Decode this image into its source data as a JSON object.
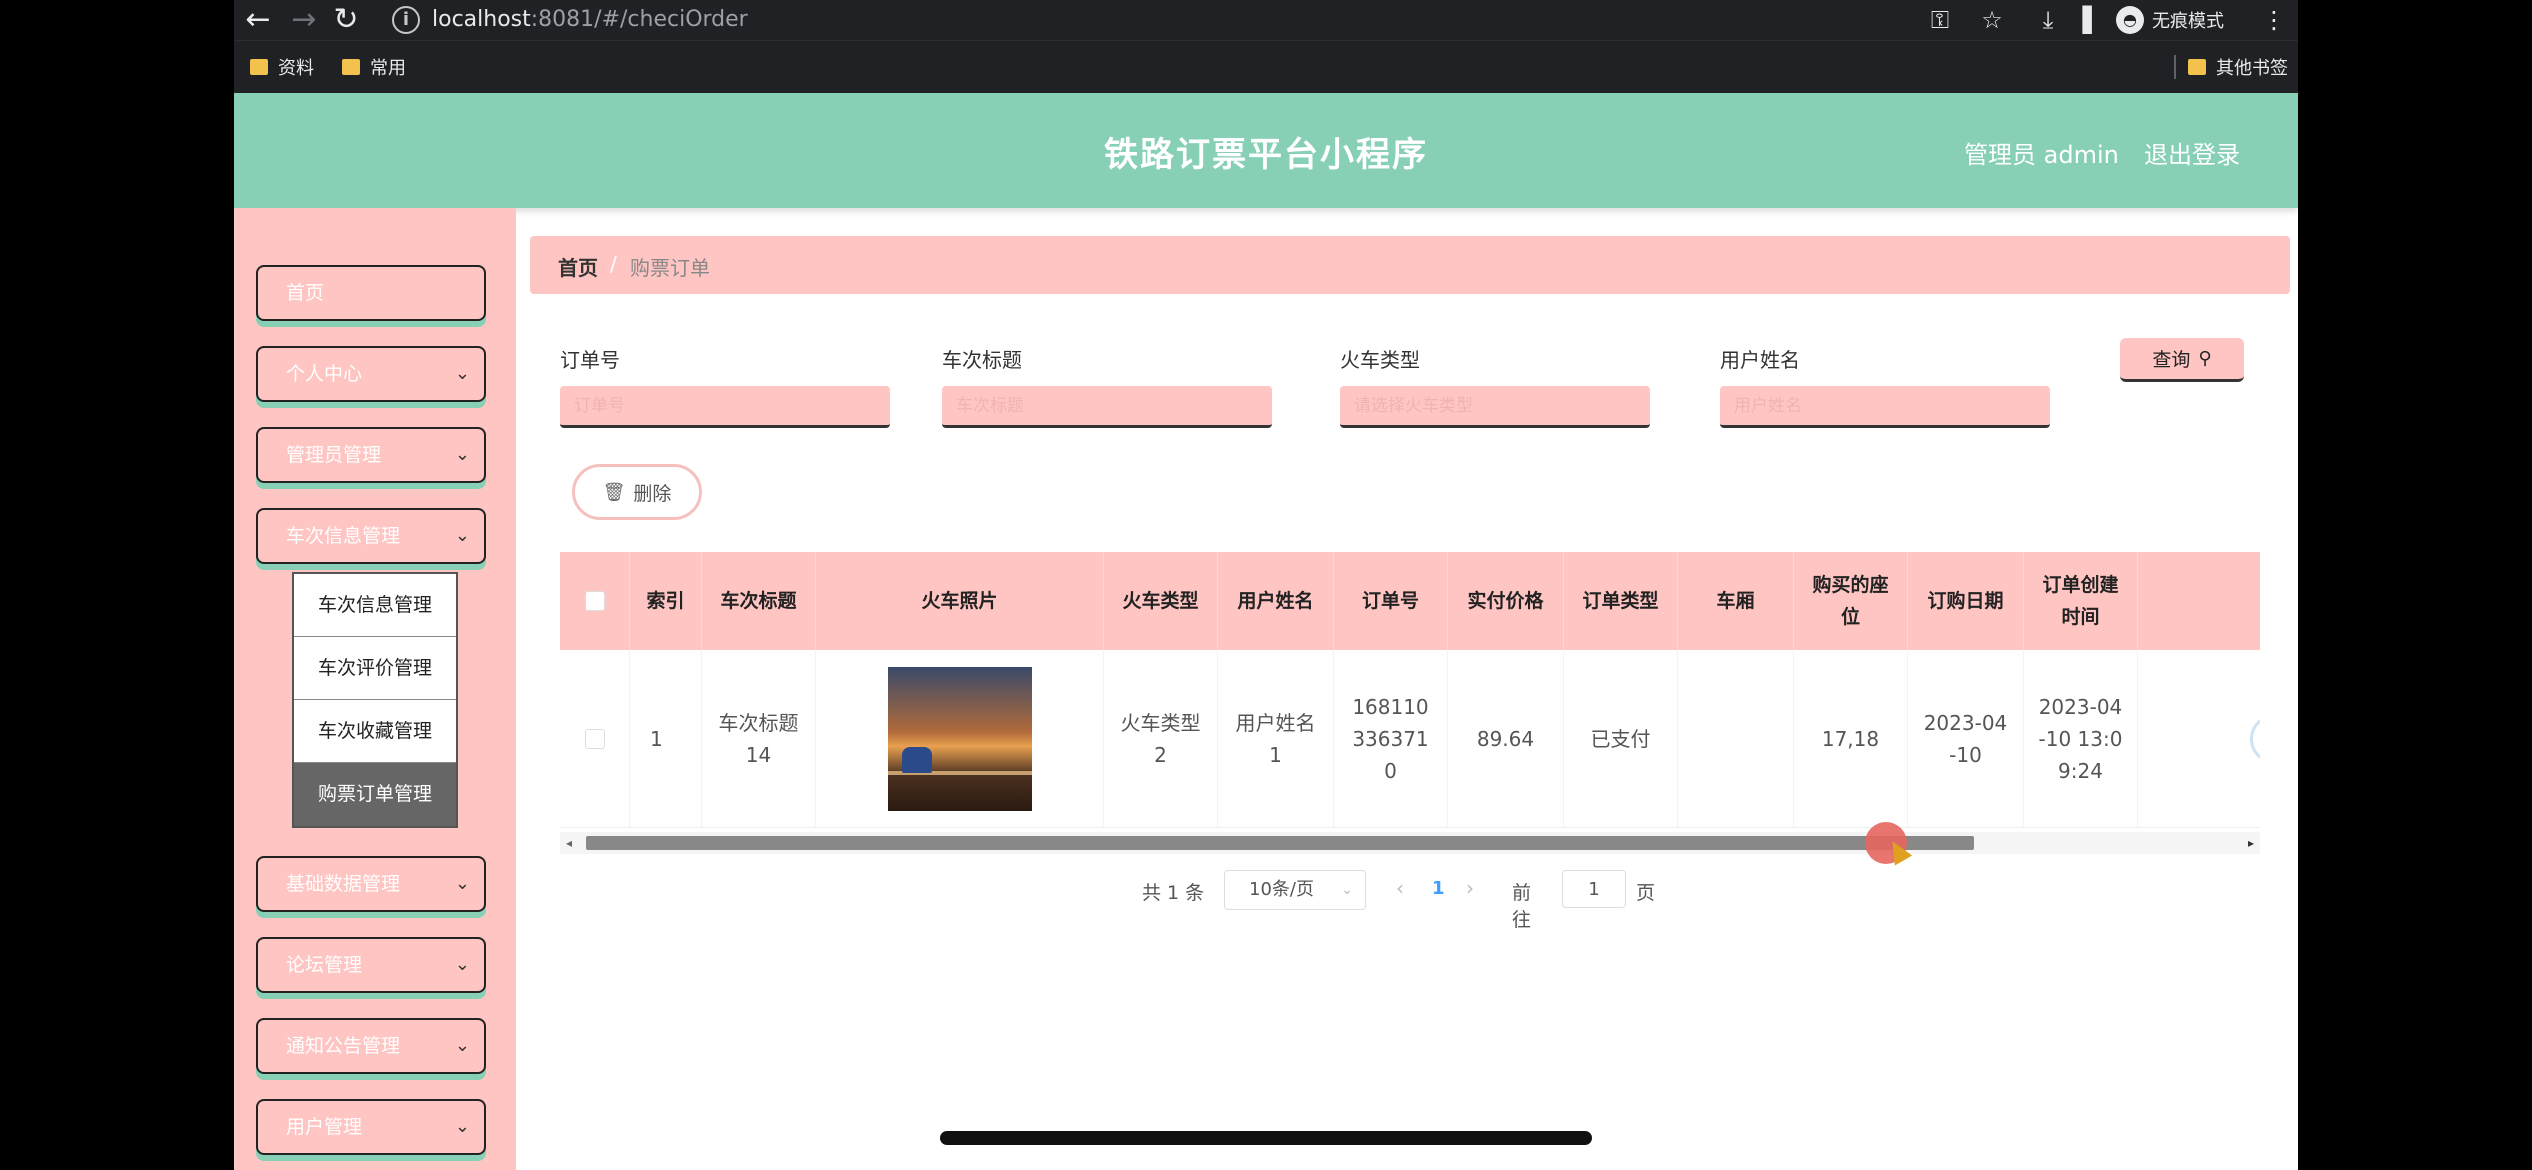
{
  "browser": {
    "url_host": "localhost",
    "url_rest": ":8081/#/checiOrder",
    "incognito_label": "无痕模式",
    "bookmarks": [
      "资料",
      "常用"
    ],
    "other_bookmarks": "其他书签"
  },
  "header": {
    "title": "铁路订票平台小程序",
    "admin": "管理员 admin",
    "logout": "退出登录",
    "accent_color": "#87d0b6"
  },
  "sidebar": {
    "items": [
      {
        "label": "首页"
      },
      {
        "label": "个人中心"
      },
      {
        "label": "管理员管理"
      },
      {
        "label": "车次信息管理"
      },
      {
        "label": "基础数据管理"
      },
      {
        "label": "论坛管理"
      },
      {
        "label": "通知公告管理"
      },
      {
        "label": "用户管理"
      }
    ],
    "submenu": [
      "车次信息管理",
      "车次评价管理",
      "车次收藏管理",
      "购票订单管理"
    ],
    "bg_color": "#ffc5c3"
  },
  "breadcrumb": {
    "home": "首页",
    "separator": "/",
    "current": "购票订单"
  },
  "filters": {
    "order_no_label": "订单号",
    "order_no_placeholder": "订单号",
    "train_title_label": "车次标题",
    "train_title_placeholder": "车次标题",
    "train_type_label": "火车类型",
    "train_type_placeholder": "请选择火车类型",
    "user_name_label": "用户姓名",
    "user_name_placeholder": "用户姓名",
    "query_label": "查询"
  },
  "actions": {
    "delete_label": "删除"
  },
  "table": {
    "headers": [
      "索引",
      "车次标题",
      "火车照片",
      "火车类型",
      "用户姓名",
      "订单号",
      "实付价格",
      "订单类型",
      "车厢",
      "购买的座位",
      "订购日期",
      "订单创建时间"
    ],
    "rows": [
      {
        "index": "1",
        "train_title": "车次标题14",
        "train_type": "火车类型2",
        "user_name": "用户姓名1",
        "order_no": "1681103363710",
        "price": "89.64",
        "order_type": "已支付",
        "carriage": "",
        "seats": "17,18",
        "order_date": "2023-04-10",
        "created_at": "2023-04-10 13:09:24"
      }
    ]
  },
  "pagination": {
    "total": "共 1 条",
    "page_size": "10条/页",
    "current_page": "1",
    "goto_label": "前往",
    "goto_value": "1",
    "goto_unit": "页"
  }
}
